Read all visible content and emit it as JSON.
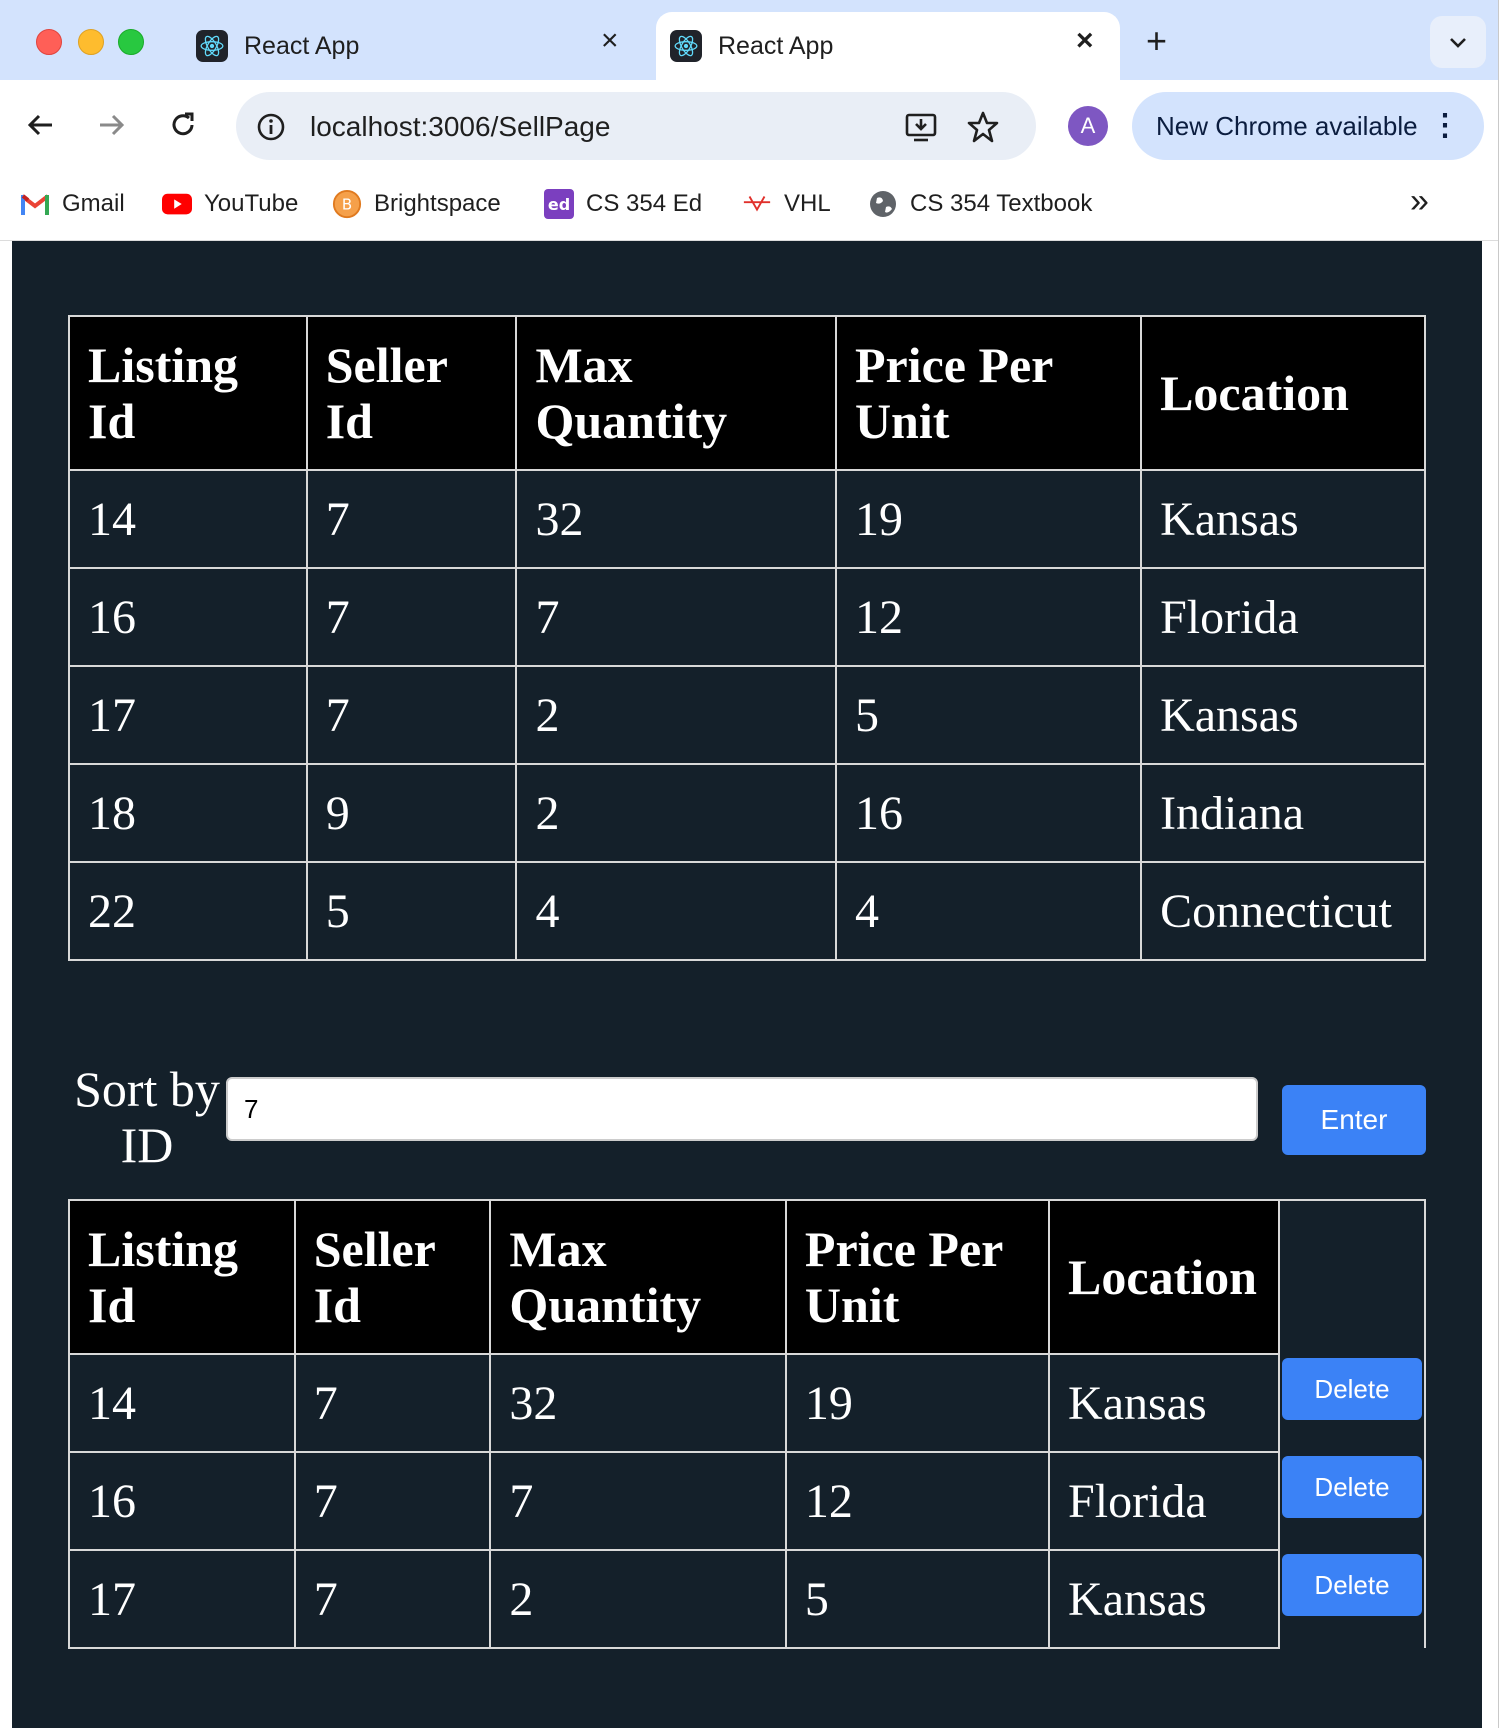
{
  "browser": {
    "tabs": [
      {
        "title": "React App",
        "active": false
      },
      {
        "title": "React App",
        "active": true
      }
    ],
    "new_tab": "+",
    "close_glyph": "×",
    "url": "localhost:3006/SellPage",
    "avatar_initial": "A",
    "update_label": "New Chrome available",
    "bookmarks": [
      {
        "label": "Gmail",
        "icon": "gmail-icon"
      },
      {
        "label": "YouTube",
        "icon": "youtube-icon"
      },
      {
        "label": "Brightspace",
        "icon": "brightspace-icon"
      },
      {
        "label": "CS 354 Ed",
        "icon": "ed-icon"
      },
      {
        "label": "VHL",
        "icon": "vhl-icon"
      },
      {
        "label": "CS 354 Textbook",
        "icon": "globe-icon"
      }
    ]
  },
  "colors": {
    "page_bg": "#14202a",
    "header_bg": "#000000",
    "button_blue": "#3b82f6"
  },
  "listings_table": {
    "headers": [
      "Listing Id",
      "Seller Id",
      "Max Quantity",
      "Price Per Unit",
      "Location"
    ],
    "rows": [
      [
        "14",
        "7",
        "32",
        "19",
        "Kansas"
      ],
      [
        "16",
        "7",
        "7",
        "12",
        "Florida"
      ],
      [
        "17",
        "7",
        "2",
        "5",
        "Kansas"
      ],
      [
        "18",
        "9",
        "2",
        "16",
        "Indiana"
      ],
      [
        "22",
        "5",
        "4",
        "4",
        "Connecticut"
      ]
    ]
  },
  "sort": {
    "label": "Sort by ID",
    "value": "7",
    "enter_label": "Enter"
  },
  "filtered_table": {
    "headers": [
      "Listing Id",
      "Seller Id",
      "Max Quantity",
      "Price Per Unit",
      "Location"
    ],
    "rows": [
      [
        "14",
        "7",
        "32",
        "19",
        "Kansas"
      ],
      [
        "16",
        "7",
        "7",
        "12",
        "Florida"
      ],
      [
        "17",
        "7",
        "2",
        "5",
        "Kansas"
      ]
    ],
    "delete_label": "Delete"
  }
}
